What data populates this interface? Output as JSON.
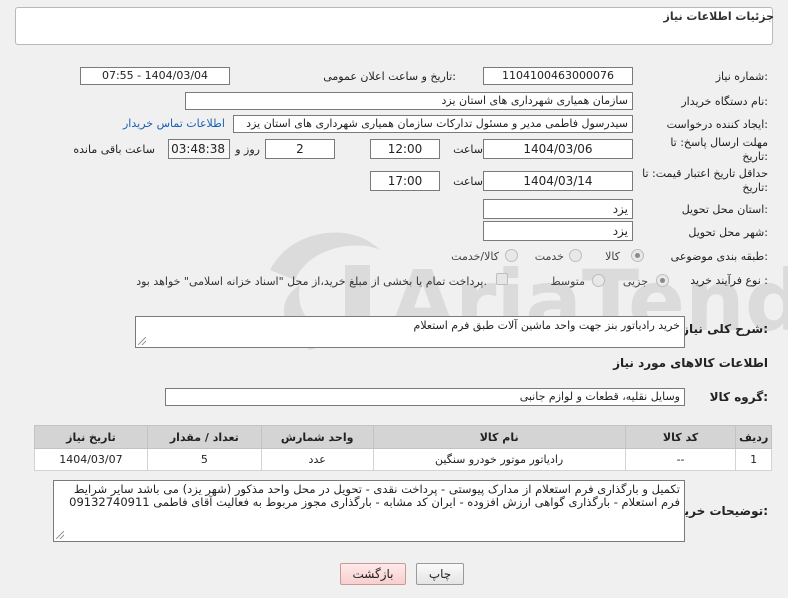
{
  "header": {
    "title": "جزئیات اطلاعات نیاز"
  },
  "fields": {
    "need_number_label": "شماره نیاز:",
    "need_number": "1104100463000076",
    "announce_label": "تاریخ و ساعت اعلان عمومی:",
    "announce_value": "1404/03/04 - 07:55",
    "buyer_org_label": "نام دستگاه خریدار:",
    "buyer_org": "سازمان همیاری شهرداری های استان یزد",
    "creator_label": "ایجاد کننده درخواست:",
    "creator": "سیدرسول فاطمی مدیر و مسئول تدارکات سازمان همیاری شهرداری های استان یزد",
    "contact_link": "اطلاعات تماس خریدار",
    "reply_deadline_label": "مهلت ارسال پاسخ: تا تاریخ:",
    "reply_date": "1404/03/06",
    "time_label": "ساعت",
    "reply_time": "12:00",
    "days_value": "2",
    "days_label": "روز و",
    "remaining_value": "03:48:38",
    "remaining_label": "ساعت باقی مانده",
    "validity_label": "حداقل تاریخ اعتبار قیمت: تا تاریخ:",
    "validity_date": "1404/03/14",
    "validity_time": "17:00",
    "province_label": "استان محل تحویل:",
    "province": "یزد",
    "city_label": "شهر محل تحویل:",
    "city": "یزد",
    "category_label": "طبقه بندی موضوعی:",
    "category_options": [
      "کالا",
      "خدمت",
      "کالا/خدمت"
    ],
    "process_label": "نوع فرآیند خرید :",
    "process_options": [
      "جزیی",
      "متوسط"
    ],
    "payment_note": "پرداخت تمام یا بخشی از مبلغ خرید،از محل \"اسناد خزانه اسلامی\" خواهد بود.",
    "desc_label": "شرح کلی نیاز:",
    "desc": "خرید رادیاتور بنز جهت واحد ماشین آلات طبق فرم استعلام",
    "goods_info_title": "اطلاعات کالاهای مورد نیاز",
    "goods_group_label": "گروه کالا:",
    "goods_group": "وسایل نقلیه، قطعات و لوازم جانبی",
    "buyer_notes_label": "توضیحات خریدار:",
    "buyer_notes": "تکمیل و بارگذاری فرم استعلام از مدارک پیوستی - پرداخت نقدی - تحویل در محل  واحد مذکور (شهر یزد) می باشد سایر شرایط فرم استعلام - بارگذاری گواهی ارزش افزوده - ایران کد مشابه - بارگذاری مجوز مربوط به فعالیت آقای فاطمی 09132740911"
  },
  "table": {
    "headers": [
      "ردیف",
      "کد کالا",
      "نام کالا",
      "واحد شمارش",
      "تعداد / مقدار",
      "تاریخ نیاز"
    ],
    "rows": [
      [
        "1",
        "--",
        "رادیاتور موتور خودرو سنگین",
        "عدد",
        "5",
        "1404/03/07"
      ]
    ]
  },
  "buttons": {
    "print": "چاپ",
    "back": "بازگشت"
  },
  "watermark": {
    "text": "AriaTender.neT"
  },
  "colors": {
    "link": "#1a5fb4",
    "header_bg": "#d4d4d4",
    "back_button": "#f7cfcf"
  }
}
